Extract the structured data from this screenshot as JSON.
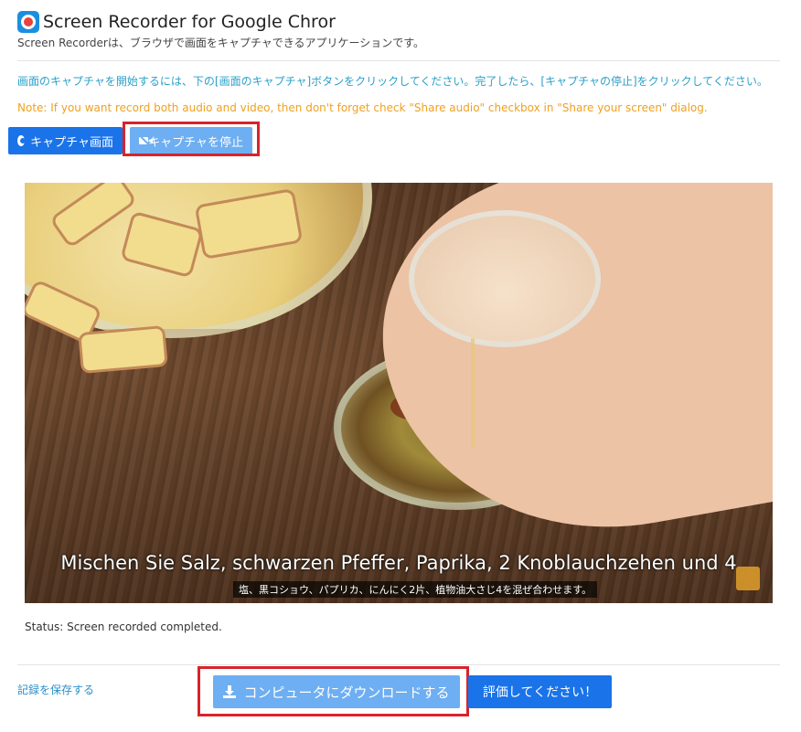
{
  "header": {
    "title": "Screen Recorder for Google Chror",
    "subtitle": "Screen Recorderは、ブラウザで画面をキャプチャできるアプリケーションです。"
  },
  "instructions": "画面のキャプチャを開始するには、下の[画面のキャプチャ]ボタンをクリックしてください。完了したら、[キャプチャの停止]をクリックしてください。",
  "note": "Note: If you want record both audio and video, then don't forget check \"Share audio\" checkbox in \"Share your screen\" dialog.",
  "toolbar": {
    "capture_label": "キャプチャ画面",
    "stop_label": "キャプチャを停止"
  },
  "video": {
    "subtitle_main": "Mischen Sie Salz, schwarzen Pfeffer, Paprika, 2 Knoblauchzehen und 4",
    "subtitle_ja": "塩、黒コショウ、パプリカ、にんにく2片、植物油大さじ4を混ぜ合わせます。"
  },
  "status": "Status: Screen recorded completed.",
  "footer": {
    "save_link": "記録を保存する",
    "download_label": "コンピュータにダウンロードする",
    "rate_label": "評価してください！"
  },
  "colors": {
    "accent": "#1a73e8",
    "accent_light": "#6eaef2",
    "highlight": "#d8232a",
    "instruction_text": "#2aa0c8",
    "note_text": "#f0a020"
  },
  "icons": [
    "record-icon",
    "camera-off-icon",
    "download-icon"
  ]
}
